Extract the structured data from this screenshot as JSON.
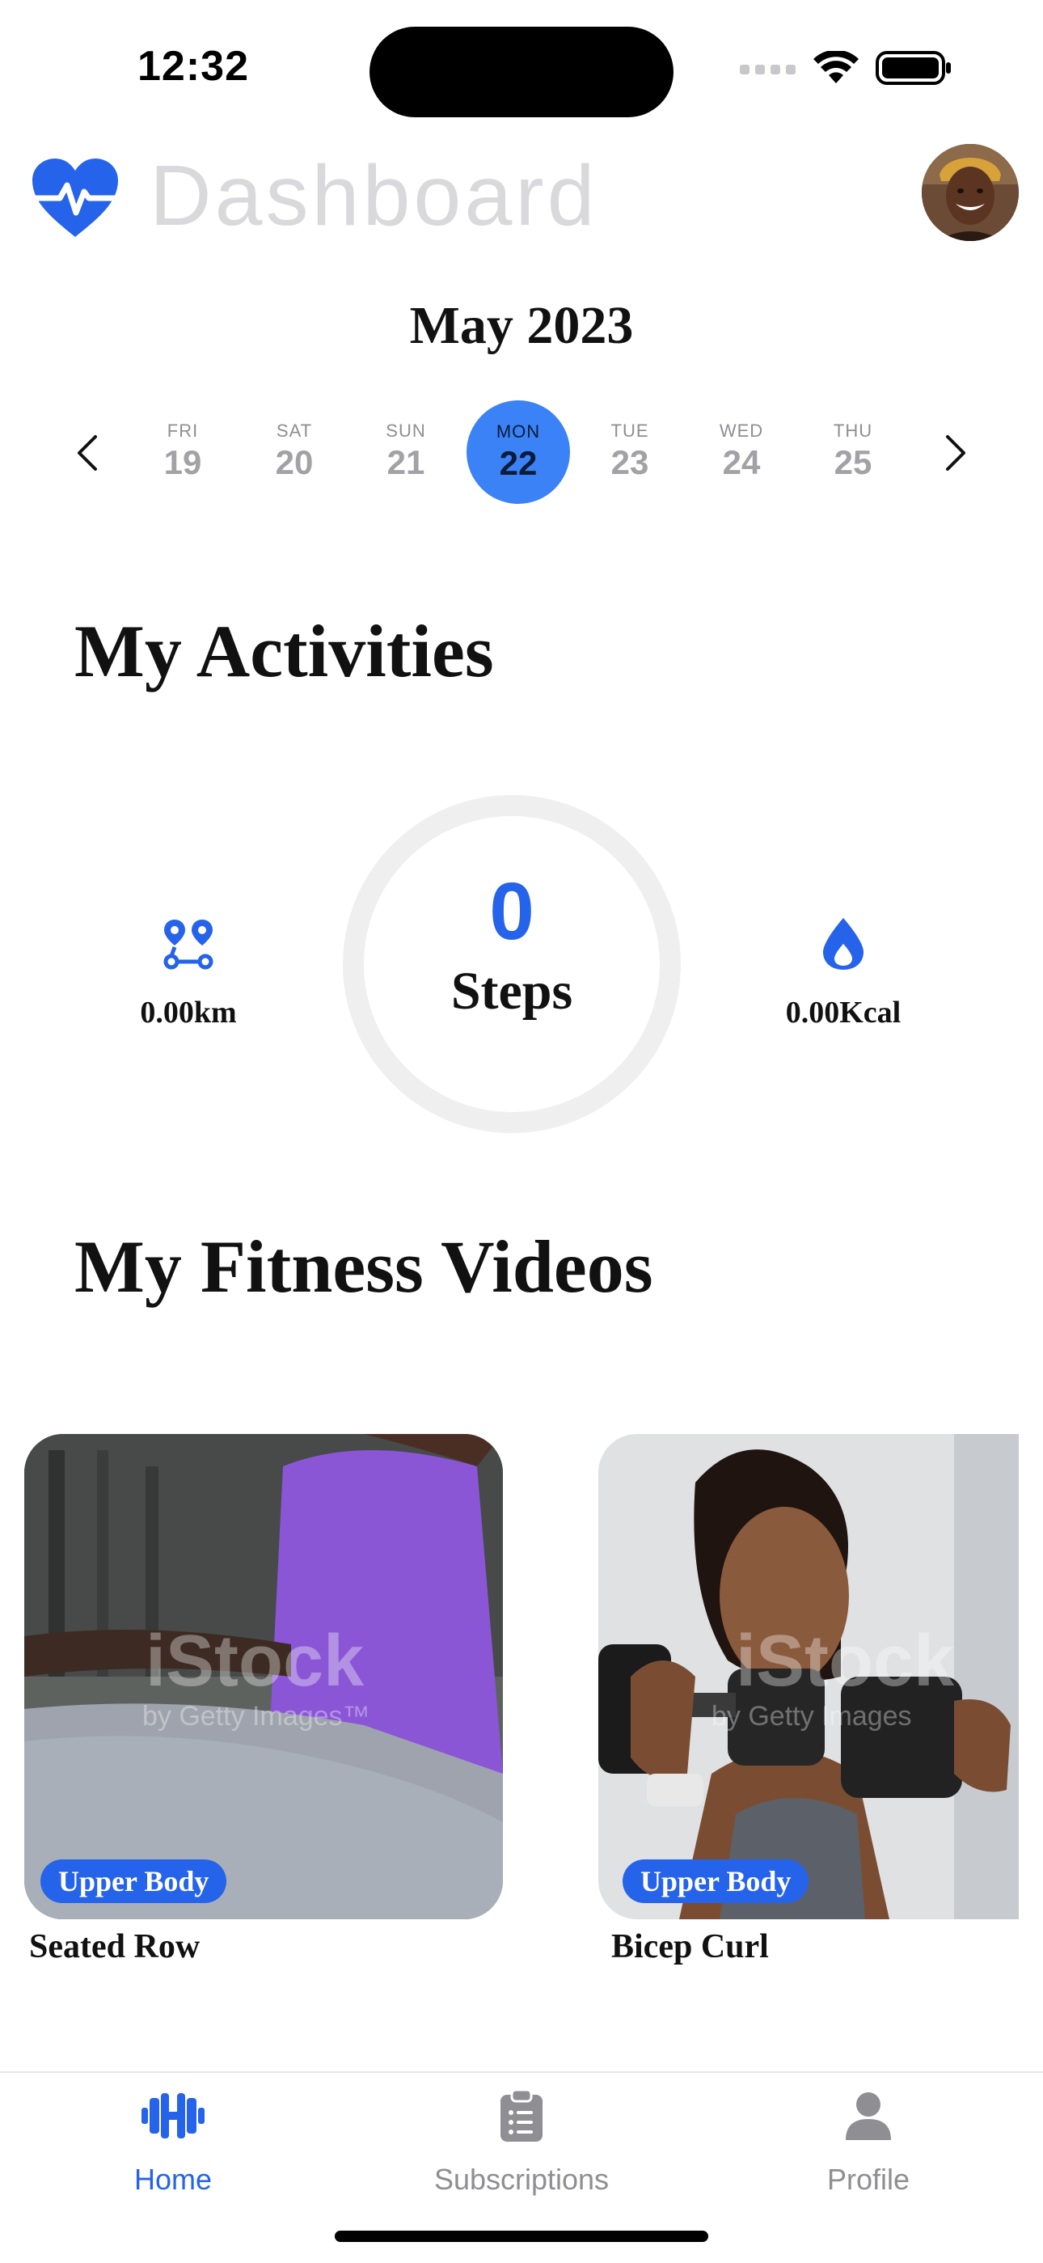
{
  "status_bar": {
    "time": "12:32"
  },
  "header": {
    "title": "Dashboard"
  },
  "calendar": {
    "month": "May 2023",
    "days": [
      {
        "dow": "FRI",
        "num": "19"
      },
      {
        "dow": "SAT",
        "num": "20"
      },
      {
        "dow": "SUN",
        "num": "21"
      },
      {
        "dow": "MON",
        "num": "22"
      },
      {
        "dow": "TUE",
        "num": "23"
      },
      {
        "dow": "WED",
        "num": "24"
      },
      {
        "dow": "THU",
        "num": "25"
      }
    ],
    "selected_index": 3
  },
  "activities": {
    "heading": "My Activities",
    "distance": "0.00km",
    "steps_value": "0",
    "steps_label": "Steps",
    "calories": "0.00Kcal"
  },
  "videos": {
    "heading": "My Fitness Videos",
    "items": [
      {
        "tag": "Upper Body",
        "title": "Seated Row",
        "watermark": "iStock",
        "watermark_sub": "by Getty Images™"
      },
      {
        "tag": "Upper Body",
        "title": "Bicep Curl",
        "watermark": "iStock",
        "watermark_sub": "by Getty Images"
      }
    ]
  },
  "tabbar": {
    "home": "Home",
    "subscriptions": "Subscriptions",
    "profile": "Profile",
    "active": "home"
  },
  "colors": {
    "accent": "#2563eb",
    "selected_day": "#3b82f6",
    "title_gray": "#d9d9dc"
  }
}
